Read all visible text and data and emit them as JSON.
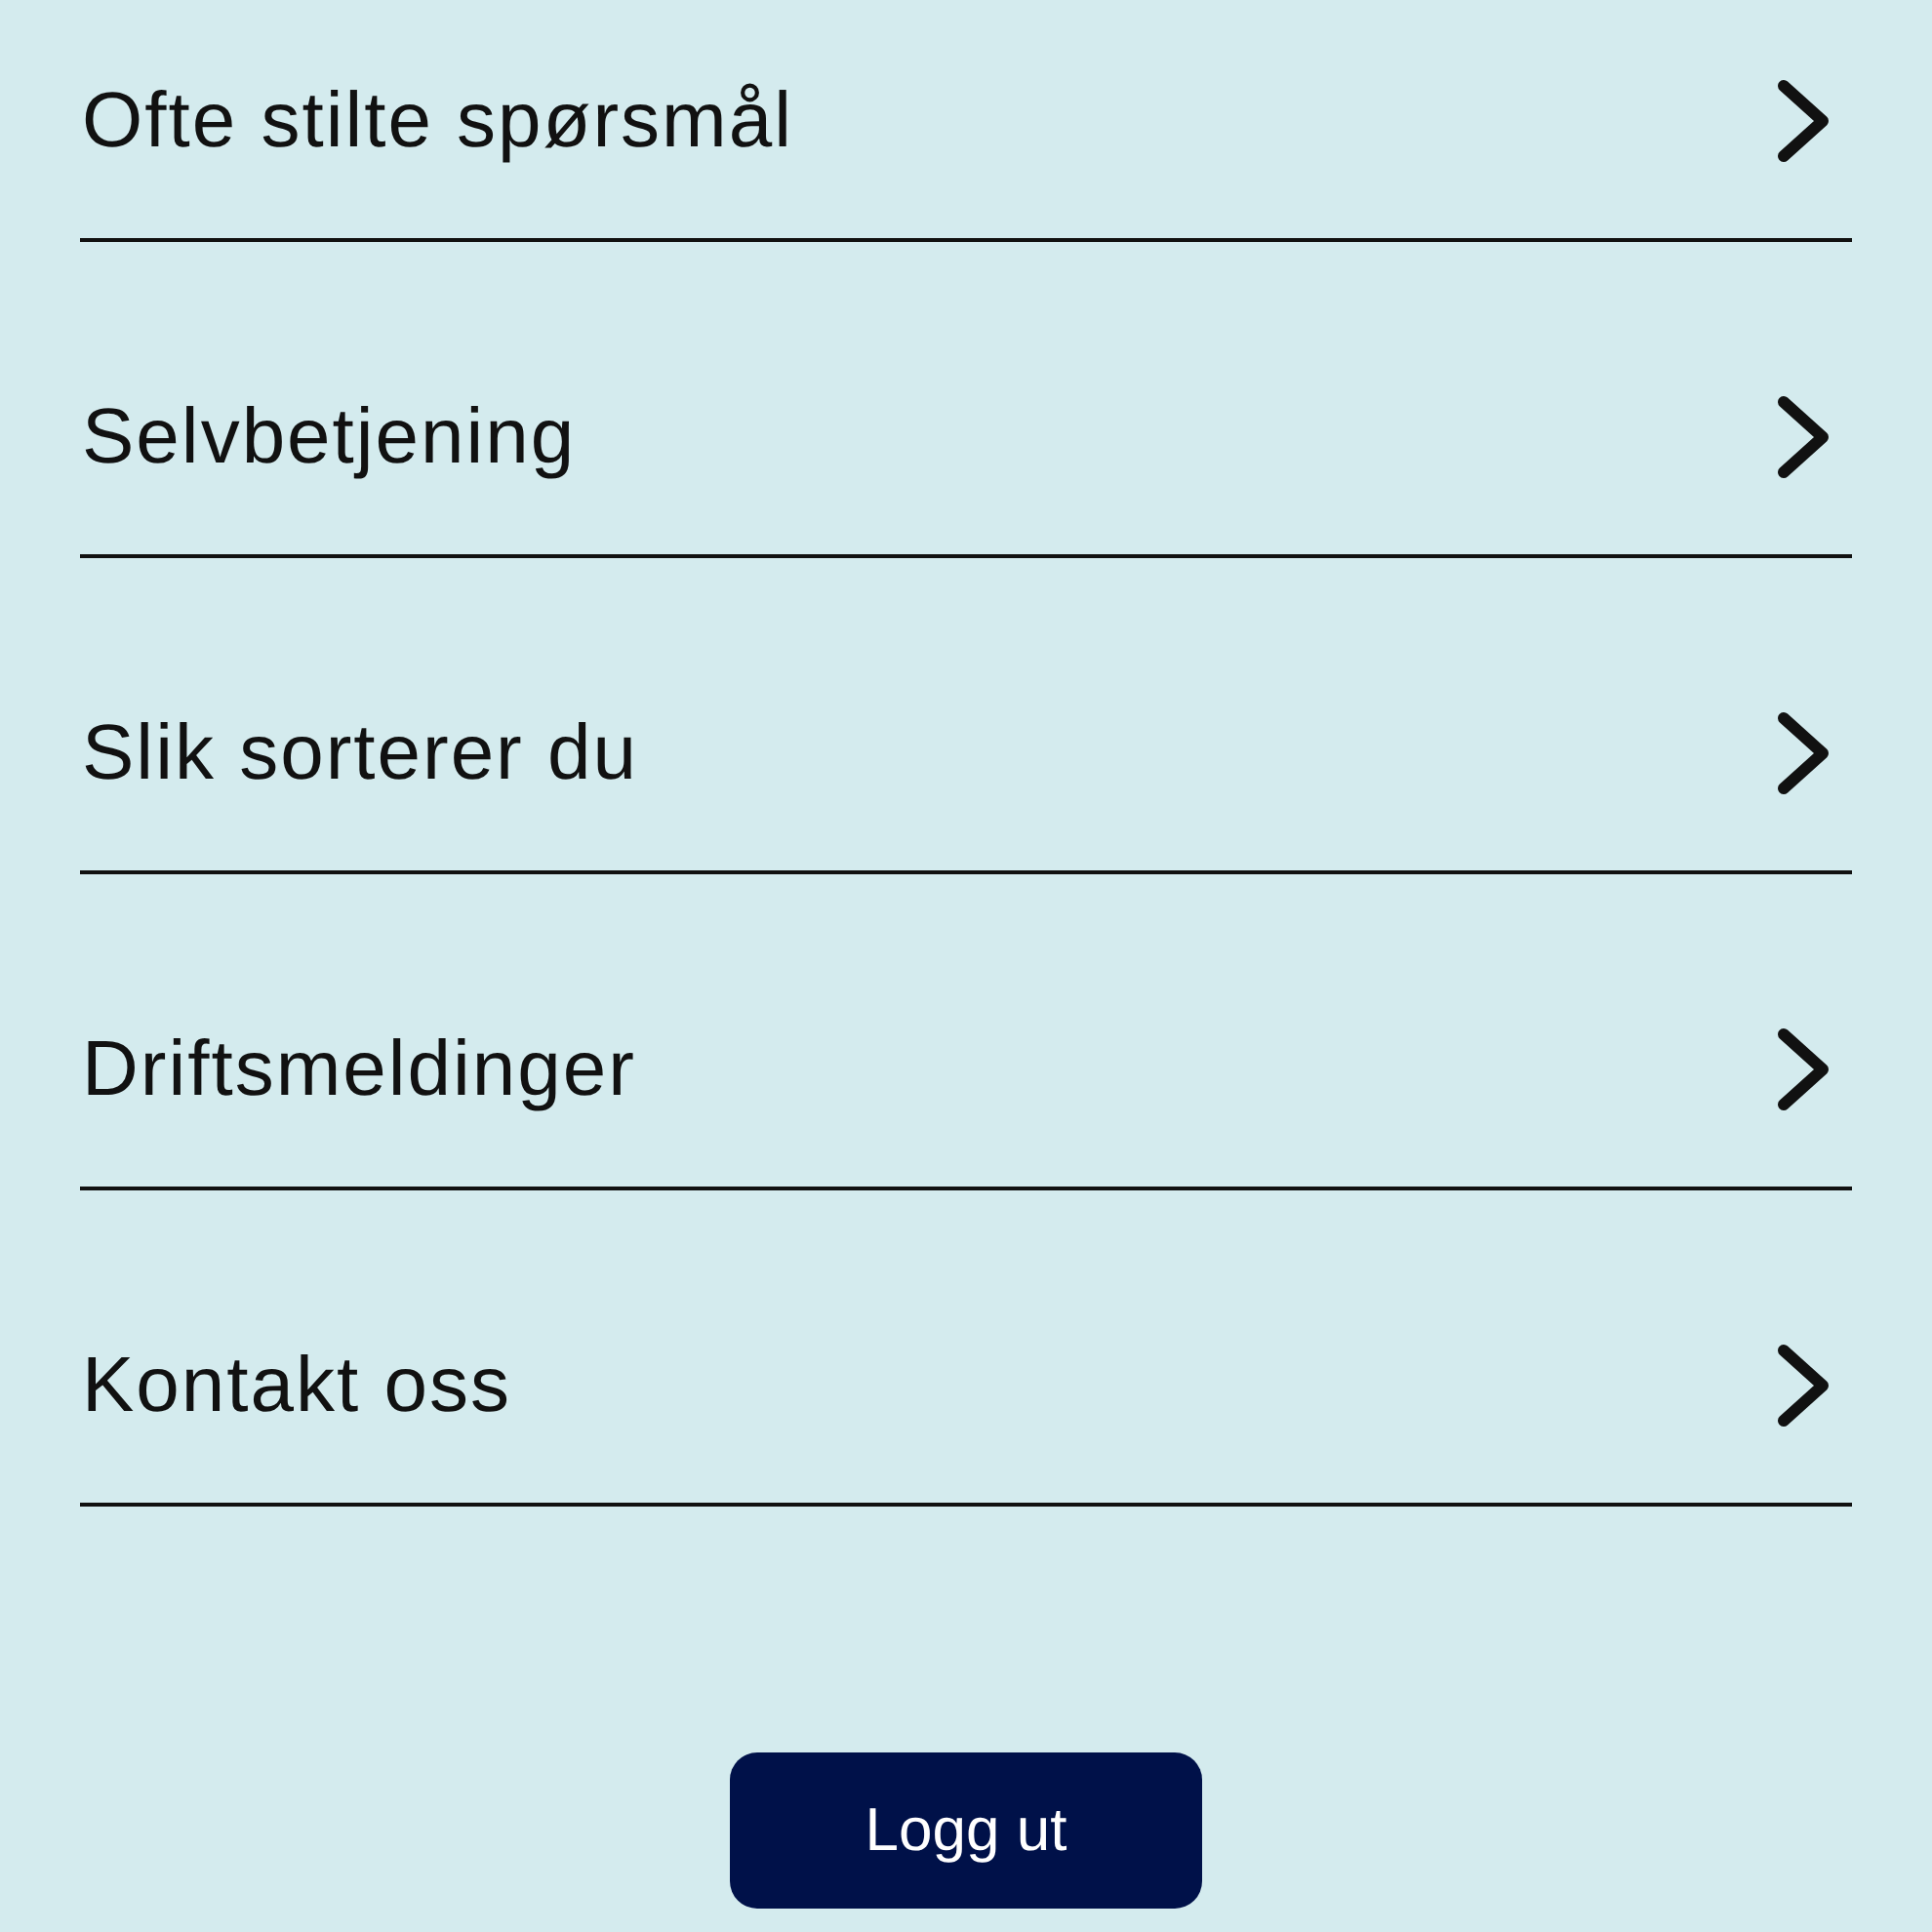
{
  "menu": [
    {
      "label": "Ofte stilte spørsmål"
    },
    {
      "label": "Selvbetjening"
    },
    {
      "label": "Slik sorterer du"
    },
    {
      "label": "Driftsmeldinger"
    },
    {
      "label": "Kontakt oss"
    }
  ],
  "logout_button": "Logg ut"
}
